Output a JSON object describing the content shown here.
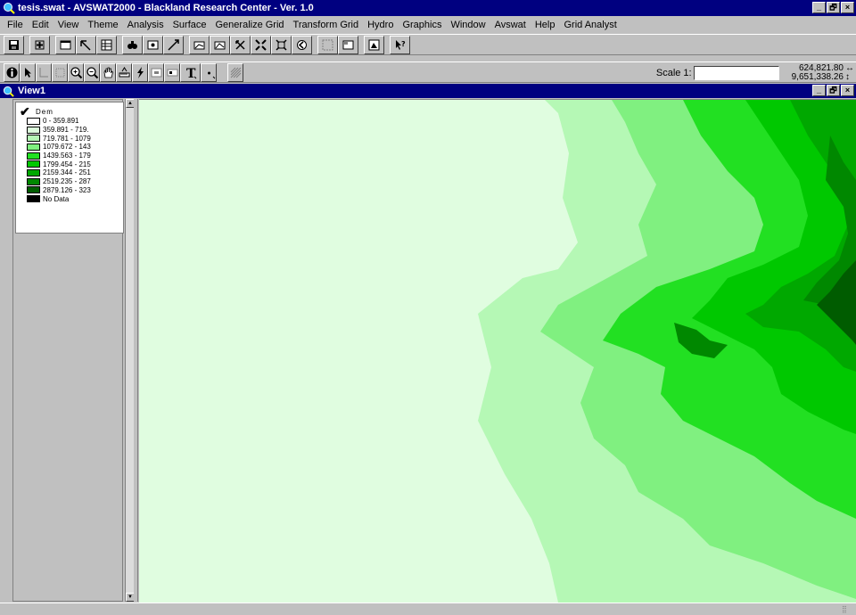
{
  "window": {
    "title": "tesis.swat - AVSWAT2000 - Blackland Research Center - Ver. 1.0",
    "controls": [
      "_",
      "🗗",
      "×"
    ]
  },
  "menu": [
    "File",
    "Edit",
    "View",
    "Theme",
    "Analysis",
    "Surface",
    "Generalize Grid",
    "Transform Grid",
    "Hydro",
    "Graphics",
    "Window",
    "Avswat",
    "Help",
    "Grid Analyst"
  ],
  "toolbar1": {
    "icons": [
      "save-icon",
      "add-theme-icon",
      "theme-properties-icon",
      "edit-legend-icon",
      "open-table-icon",
      "find-icon",
      "locate-icon",
      "query-builder-icon",
      "zoom-full-extent-icon",
      "zoom-active-theme-icon",
      "zoom-selected-icon",
      "zoom-in-fixed-icon",
      "zoom-out-fixed-icon",
      "zoom-previous-icon",
      "select-none-icon",
      "print-icon",
      "help-icon"
    ]
  },
  "toolbar2": {
    "icons": [
      "identify-icon",
      "pointer-icon",
      "vertex-edit-icon",
      "select-feature-icon",
      "zoom-in-icon",
      "zoom-out-icon",
      "pan-icon",
      "measure-icon",
      "hotlink-icon",
      "area-of-interest-icon",
      "label-icon",
      "text-icon",
      "draw-point-icon",
      "snap-icon"
    ],
    "scale_label": "Scale 1:",
    "scale_value": "",
    "coord_x": "624,821.80",
    "coord_y": "9,651,338.26"
  },
  "view": {
    "title": "View1",
    "controls": [
      "_",
      "🗗",
      "×"
    ]
  },
  "toc": {
    "theme_name": "Dem",
    "checked": true,
    "legend": [
      {
        "label": "0 - 359.891",
        "color": "#ffffff"
      },
      {
        "label": "359.891 - 719.",
        "color": "#dcfddc"
      },
      {
        "label": "719.781 - 1079",
        "color": "#b5f8b5"
      },
      {
        "label": "1079.672 - 143",
        "color": "#80f080"
      },
      {
        "label": "1439.563 - 179",
        "color": "#22e022"
      },
      {
        "label": "1799.454 - 215",
        "color": "#00c800"
      },
      {
        "label": "2159.344 - 251",
        "color": "#00a800"
      },
      {
        "label": "2519.235 - 287",
        "color": "#008800"
      },
      {
        "label": "2879.126 - 323",
        "color": "#005c00"
      },
      {
        "label": "No Data",
        "color": "#000000"
      }
    ]
  },
  "map": {
    "background": "#e0fde0"
  }
}
